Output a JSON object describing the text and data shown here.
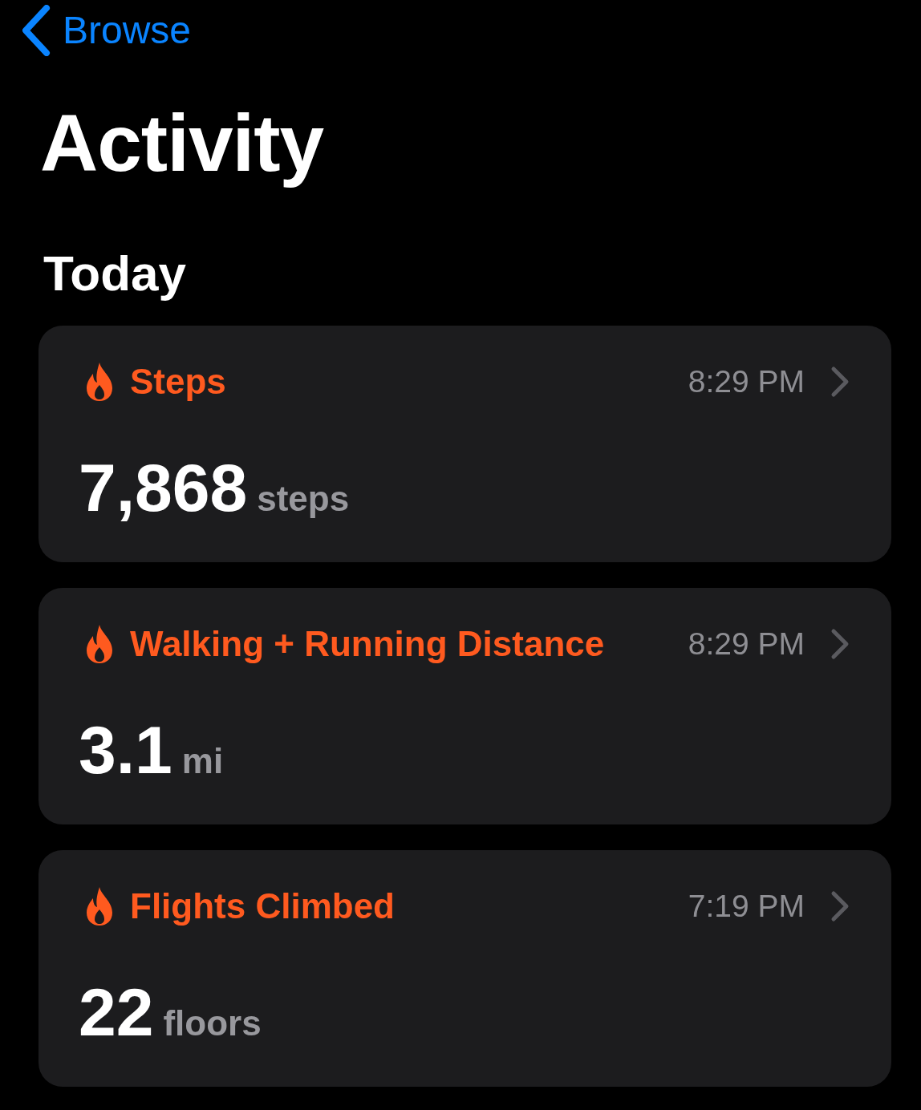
{
  "nav": {
    "back_label": "Browse"
  },
  "title": "Activity",
  "section": "Today",
  "cards": [
    {
      "title": "Steps",
      "time": "8:29 PM",
      "value": "7,868",
      "unit": "steps"
    },
    {
      "title": "Walking + Running Distance",
      "time": "8:29 PM",
      "value": "3.1",
      "unit": "mi"
    },
    {
      "title": "Flights Climbed",
      "time": "7:19 PM",
      "value": "22",
      "unit": "floors"
    }
  ]
}
